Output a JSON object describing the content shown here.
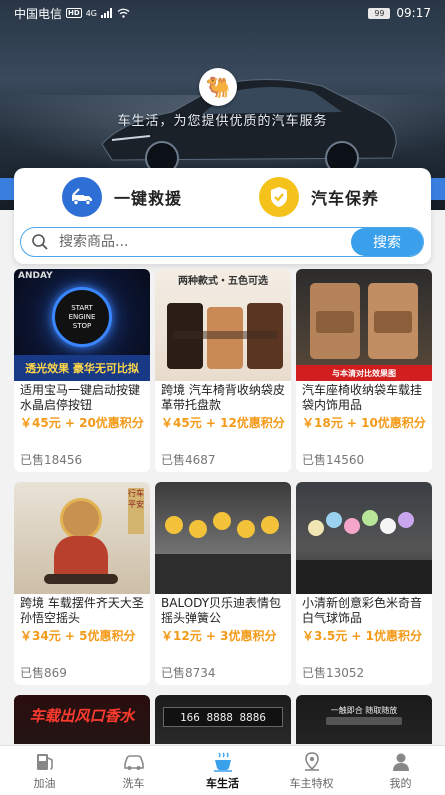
{
  "status_bar": {
    "carrier": "中国电信",
    "hd": "HD",
    "network": "4G",
    "battery": "99",
    "time": "09:17"
  },
  "banner": {
    "slogan": "车生活，为您提供优质的汽车服务"
  },
  "services": [
    {
      "label": "一键救援",
      "icon": "tow-truck-icon"
    },
    {
      "label": "汽车保养",
      "icon": "shield-check-icon"
    }
  ],
  "search": {
    "placeholder": "搜索商品...",
    "button": "搜索"
  },
  "products": [
    {
      "title": "适用宝马一键启动按键水晶启停按钮",
      "price": "￥45元 + 20优惠积分",
      "sold": "已售18456",
      "thumb_caption": "透光效果 豪华无可比拟",
      "thumb_brand": "ANDAY",
      "thumb_center": "START ENGINE STOP"
    },
    {
      "title": "跨境 汽车椅背收纳袋皮革带托盘款",
      "price": "￥45元 + 12优惠积分",
      "sold": "已售4687",
      "thumb_caption": "两种款式・五色可选",
      "thumb_brand": "",
      "thumb_center": ""
    },
    {
      "title": "汽车座椅收纳袋车载挂袋内饰用品",
      "price": "￥18元 + 10优惠积分",
      "sold": "已售14560",
      "thumb_caption": "与本清对比效果图",
      "thumb_brand": "",
      "thumb_center": ""
    },
    {
      "title": "跨境 车载摆件齐天大圣孙悟空摇头",
      "price": "￥34元 + 5优惠积分",
      "sold": "已售869",
      "thumb_caption": "",
      "thumb_brand": "",
      "thumb_center": ""
    },
    {
      "title": "BALODY贝乐迪表情包摇头弹簧公",
      "price": "￥12元 + 3优惠积分",
      "sold": "已售8734",
      "thumb_caption": "",
      "thumb_brand": "",
      "thumb_center": ""
    },
    {
      "title": "小清新创意彩色米奇音白气球饰品",
      "price": "￥3.5元 + 1优惠积分",
      "sold": "已售13052",
      "thumb_caption": "",
      "thumb_brand": "",
      "thumb_center": ""
    },
    {
      "title": "",
      "price": "",
      "sold": "",
      "thumb_caption": "车载出风口香水",
      "thumb_brand": "",
      "thumb_center": ""
    },
    {
      "title": "",
      "price": "",
      "sold": "",
      "thumb_caption": "",
      "thumb_brand": "",
      "thumb_center": "166 8888 8886"
    },
    {
      "title": "",
      "price": "",
      "sold": "",
      "thumb_caption": "一触即合 随取随放",
      "thumb_brand": "",
      "thumb_center": ""
    }
  ],
  "tabs": [
    {
      "label": "加油",
      "icon": "fuel-pump-icon",
      "active": false
    },
    {
      "label": "洗车",
      "icon": "car-icon",
      "active": false
    },
    {
      "label": "车生活",
      "icon": "coffee-cup-icon",
      "active": true
    },
    {
      "label": "车主特权",
      "icon": "location-badge-icon",
      "active": false
    },
    {
      "label": "我的",
      "icon": "person-icon",
      "active": false
    }
  ],
  "colors": {
    "accent_blue": "#3aa0ec",
    "price_orange": "#f39a18",
    "rescue_blue": "#2e6fd6",
    "maint_yellow": "#f4c21a"
  }
}
